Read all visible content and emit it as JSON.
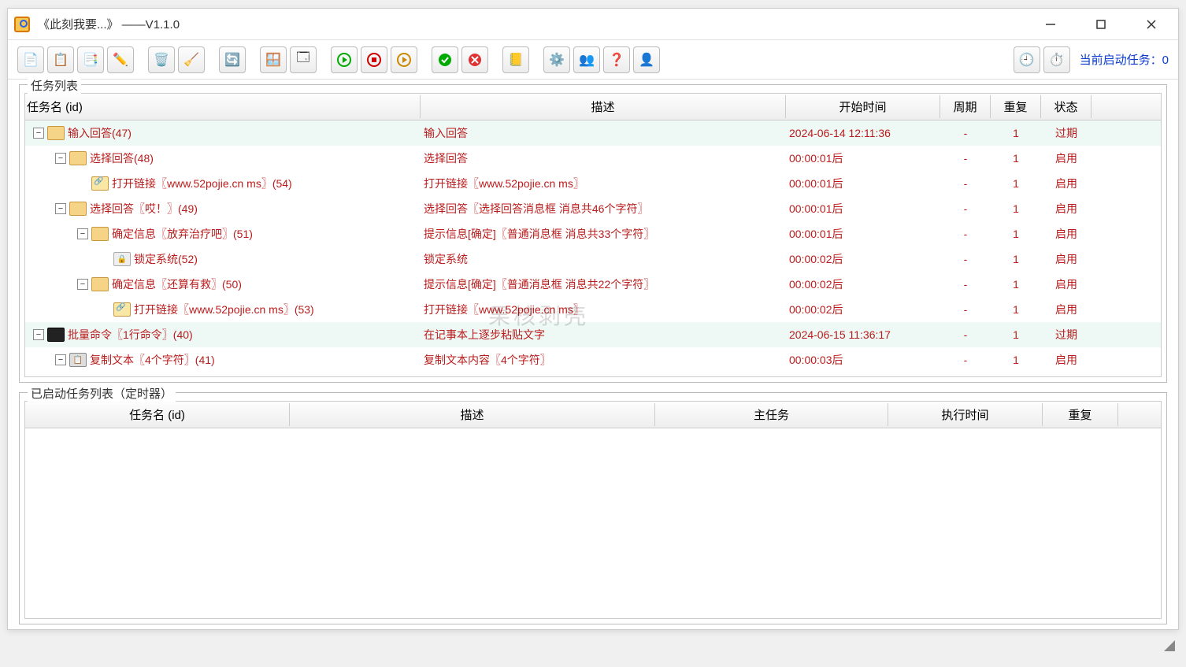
{
  "window": {
    "title": "《此刻我要...》   ——V1.1.0"
  },
  "toolbar": {
    "status_label": "当前启动任务：",
    "status_count": "0"
  },
  "task_panel": {
    "legend": "任务列表",
    "columns": {
      "name": "任务名 (id)",
      "desc": "描述",
      "time": "开始时间",
      "cycle": "周期",
      "repeat": "重复",
      "status": "状态"
    },
    "rows": [
      {
        "indent": 0,
        "icon": "dlg",
        "name": "输入回答(47)",
        "desc": "输入回答",
        "time": "2024-06-14 12:11:36",
        "cycle": "-",
        "repeat": "1",
        "status": "过期",
        "expired": true
      },
      {
        "indent": 1,
        "icon": "dlg",
        "name": "选择回答(48)",
        "desc": "选择回答",
        "time": "00:00:01后",
        "cycle": "-",
        "repeat": "1",
        "status": "启用"
      },
      {
        "indent": 2,
        "icon": "link",
        "name": "打开链接〖www.52pojie.cn ms〗(54)",
        "desc": "打开链接〖www.52pojie.cn ms〗",
        "time": "00:00:01后",
        "cycle": "-",
        "repeat": "1",
        "status": "启用",
        "leaf": true
      },
      {
        "indent": 1,
        "icon": "dlg",
        "name": "选择回答〖哎！〗(49)",
        "desc": "选择回答〖选择回答消息框  消息共46个字符〗",
        "time": "00:00:01后",
        "cycle": "-",
        "repeat": "1",
        "status": "启用"
      },
      {
        "indent": 2,
        "icon": "dlg",
        "name": "确定信息〖放弃治疗吧〗(51)",
        "desc": "提示信息[确定]〖普通消息框  消息共33个字符〗",
        "time": "00:00:01后",
        "cycle": "-",
        "repeat": "1",
        "status": "启用"
      },
      {
        "indent": 3,
        "icon": "lock",
        "name": "锁定系统(52)",
        "desc": "锁定系统",
        "time": "00:00:02后",
        "cycle": "-",
        "repeat": "1",
        "status": "启用",
        "leaf": true
      },
      {
        "indent": 2,
        "icon": "dlg",
        "name": "确定信息〖还算有救〗(50)",
        "desc": "提示信息[确定]〖普通消息框  消息共22个字符〗",
        "time": "00:00:02后",
        "cycle": "-",
        "repeat": "1",
        "status": "启用"
      },
      {
        "indent": 3,
        "icon": "link",
        "name": "打开链接〖www.52pojie.cn ms〗(53)",
        "desc": "打开链接〖www.52pojie.cn ms〗",
        "time": "00:00:02后",
        "cycle": "-",
        "repeat": "1",
        "status": "启用",
        "leaf": true
      },
      {
        "indent": 0,
        "icon": "cmd",
        "name": "批量命令〖1行命令〗(40)",
        "desc": "在记事本上逐步粘贴文字",
        "time": "2024-06-15 11:36:17",
        "cycle": "-",
        "repeat": "1",
        "status": "过期",
        "expired": true
      },
      {
        "indent": 1,
        "icon": "copy",
        "name": "复制文本〖4个字符〗(41)",
        "desc": "复制文本内容〖4个字符〗",
        "time": "00:00:03后",
        "cycle": "-",
        "repeat": "1",
        "status": "启用"
      }
    ]
  },
  "running_panel": {
    "legend": "已启动任务列表（定时器）",
    "columns": {
      "name": "任务名 (id)",
      "desc": "描述",
      "main": "主任务",
      "time": "执行时间",
      "repeat": "重复"
    }
  },
  "watermark": "果核剥壳"
}
